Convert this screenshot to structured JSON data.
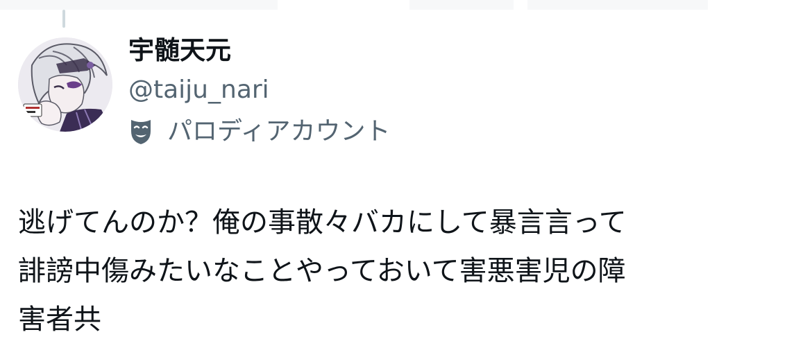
{
  "tweet": {
    "author": {
      "display_name": "宇髄天元",
      "handle": "@taiju_nari",
      "parody_label": "パロディアカウント",
      "avatar_icon": "anime-character-avatar",
      "parody_icon": "theater-mask-icon"
    },
    "text_lines": [
      "逃げてんのか？俺の事散々バカにして暴言言って",
      "誹謗中傷みたいなことやっておいて害悪害児の障",
      "害者共"
    ]
  },
  "colors": {
    "text_primary": "#0f1419",
    "text_secondary": "#536471",
    "thread_line": "#cfd9de",
    "background": "#ffffff"
  }
}
